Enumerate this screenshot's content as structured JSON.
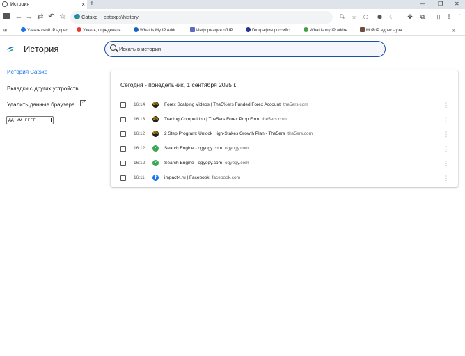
{
  "tab": {
    "title": "История",
    "close": "×",
    "new_tab": "+"
  },
  "window_controls": {
    "minimize": "—",
    "restore": "❐",
    "close": "✕"
  },
  "omnibox": {
    "site_name": "Catsxp",
    "url": "catsxp://history"
  },
  "bookmarks": [
    {
      "label": "Узнать свой IP адрес",
      "color": "#1a73e8"
    },
    {
      "label": "Узнать, определить...",
      "color": "#e53935"
    },
    {
      "label": "What Is My IP Addr...",
      "color": "#1565c0"
    },
    {
      "label": "Информация об IP...",
      "color": "#5c6bc0"
    },
    {
      "label": "География российс...",
      "color": "#283593"
    },
    {
      "label": "What is my IP addre...",
      "color": "#43a047"
    },
    {
      "label": "Мой IP адрес - узн...",
      "color": "#6d4c41"
    }
  ],
  "bookmarks_more": "»",
  "page": {
    "title": "История",
    "search_placeholder": "Искать в истории"
  },
  "sidebar": {
    "history_link": "История Catsxp",
    "other_devices": "Вкладки с других устройств",
    "clear_data": "Удалить данные браузера",
    "date_placeholder": "дд-мм-гггг"
  },
  "history": {
    "heading": "Сегодня - понедельник, 1 сентября 2025 г.",
    "items": [
      {
        "time": "16:14",
        "title": "Forex Scalping Videos | The5%ers Funded Forex Account",
        "domain": "the5ers.com",
        "favicon": "5%",
        "favicon_color": "#1f1f1f"
      },
      {
        "time": "16:13",
        "title": "Trading Competition | The5ers Forex Prop Firm",
        "domain": "the5ers.com",
        "favicon": "5%",
        "favicon_color": "#1f1f1f"
      },
      {
        "time": "16:12",
        "title": "2 Step Program: Unlock High-Stakes Growth Plan - The5ers",
        "domain": "the5ers.com",
        "favicon": "5%",
        "favicon_color": "#1f1f1f"
      },
      {
        "time": "16:12",
        "title": "Search Engine - ogyogy.com",
        "domain": "ogyogy.com",
        "favicon": "✓",
        "favicon_color": "#34a853"
      },
      {
        "time": "16:12",
        "title": "Search Engine - ogyogy.com",
        "domain": "ogyogy.com",
        "favicon": "✓",
        "favicon_color": "#34a853"
      },
      {
        "time": "16:11",
        "title": "impact-t.ru | Facebook",
        "domain": "facebook.com",
        "favicon": "f",
        "favicon_color": "#1877f2"
      }
    ],
    "menu_glyph": "⋮"
  }
}
